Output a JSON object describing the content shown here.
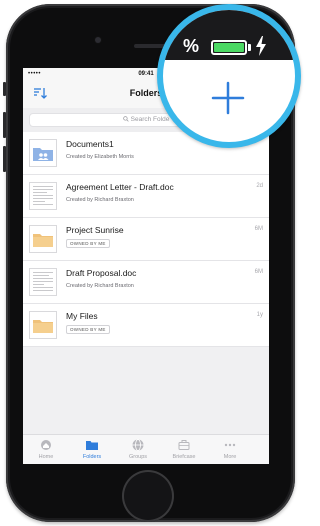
{
  "colors": {
    "accent": "#2f7ddb",
    "callout_border": "#39b7ea",
    "battery": "#4cd964",
    "folder": "#f0c27a",
    "shared_folder": "#8fb3e6"
  },
  "status_bar": {
    "signal": "•••••",
    "time": "09:41"
  },
  "nav": {
    "title": "Folders",
    "sort_icon": "sort-icon"
  },
  "search": {
    "placeholder": "Search Folde"
  },
  "items": [
    {
      "title": "Documents1",
      "subtitle": "Created by Elizabeth Morris",
      "meta": "",
      "icon": "shared-folder-icon"
    },
    {
      "title": "Agreement Letter - Draft.doc",
      "subtitle": "Created by Richard Braxton",
      "meta": "2d",
      "icon": "document-icon"
    },
    {
      "title": "Project Sunrise",
      "badge": "OWNED BY ME",
      "meta": "6M",
      "icon": "folder-icon"
    },
    {
      "title": "Draft Proposal.doc",
      "subtitle": "Created by Richard Braxton",
      "meta": "6M",
      "icon": "document-icon"
    },
    {
      "title": "My Files",
      "badge": "OWNED BY ME",
      "meta": "1y",
      "icon": "folder-icon"
    }
  ],
  "tabs": [
    {
      "label": "Home",
      "icon": "home-icon",
      "active": false
    },
    {
      "label": "Folders",
      "icon": "folder-icon",
      "active": true
    },
    {
      "label": "Groups",
      "icon": "groups-icon",
      "active": false
    },
    {
      "label": "Briefcase",
      "icon": "briefcase-icon",
      "active": false
    },
    {
      "label": "More",
      "icon": "more-icon",
      "active": false
    }
  ],
  "callout": {
    "battery_percent_text": "%",
    "plus_icon": "plus-icon"
  }
}
